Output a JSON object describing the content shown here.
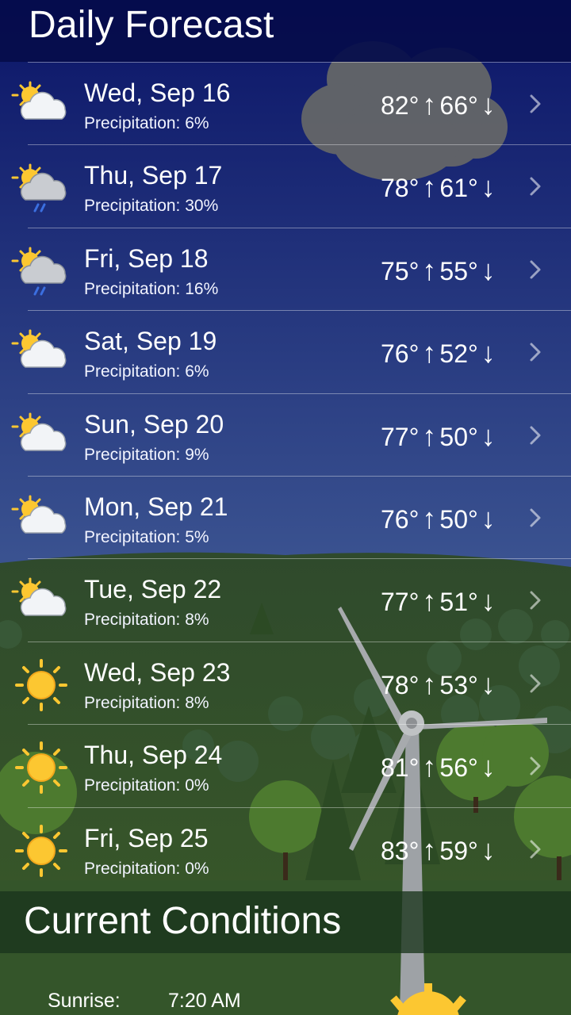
{
  "header": {
    "title": "Daily Forecast"
  },
  "forecast": [
    {
      "day": "Wed, Sep 16",
      "precip": "Precipitation: 6%",
      "high": "82°",
      "low": "66°",
      "icon": "partly-cloudy-icon"
    },
    {
      "day": "Thu, Sep 17",
      "precip": "Precipitation: 30%",
      "high": "78°",
      "low": "61°",
      "icon": "partly-cloudy-rain-icon"
    },
    {
      "day": "Fri, Sep 18",
      "precip": "Precipitation: 16%",
      "high": "75°",
      "low": "55°",
      "icon": "partly-cloudy-rain-icon"
    },
    {
      "day": "Sat, Sep 19",
      "precip": "Precipitation: 6%",
      "high": "76°",
      "low": "52°",
      "icon": "partly-cloudy-icon"
    },
    {
      "day": "Sun, Sep 20",
      "precip": "Precipitation: 9%",
      "high": "77°",
      "low": "50°",
      "icon": "partly-cloudy-icon"
    },
    {
      "day": "Mon, Sep 21",
      "precip": "Precipitation: 5%",
      "high": "76°",
      "low": "50°",
      "icon": "partly-cloudy-icon"
    },
    {
      "day": "Tue, Sep 22",
      "precip": "Precipitation: 8%",
      "high": "77°",
      "low": "51°",
      "icon": "partly-cloudy-icon"
    },
    {
      "day": "Wed, Sep 23",
      "precip": "Precipitation: 8%",
      "high": "78°",
      "low": "53°",
      "icon": "sunny-icon"
    },
    {
      "day": "Thu, Sep 24",
      "precip": "Precipitation: 0%",
      "high": "81°",
      "low": "56°",
      "icon": "sunny-icon"
    },
    {
      "day": "Fri, Sep 25",
      "precip": "Precipitation: 0%",
      "high": "83°",
      "low": "59°",
      "icon": "sunny-icon"
    }
  ],
  "arrows": {
    "up": "↑",
    "down": "↓"
  },
  "current": {
    "title": "Current Conditions",
    "sunrise_label": "Sunrise:",
    "sunrise_value": "7:20 AM"
  },
  "colors": {
    "sky_top": "#0b1568",
    "sky_bottom": "#3a5290",
    "hills": "#2f4a2c",
    "sun": "#fcc731",
    "cloud": "#e9ecf2",
    "rain": "#3b6fe0"
  }
}
